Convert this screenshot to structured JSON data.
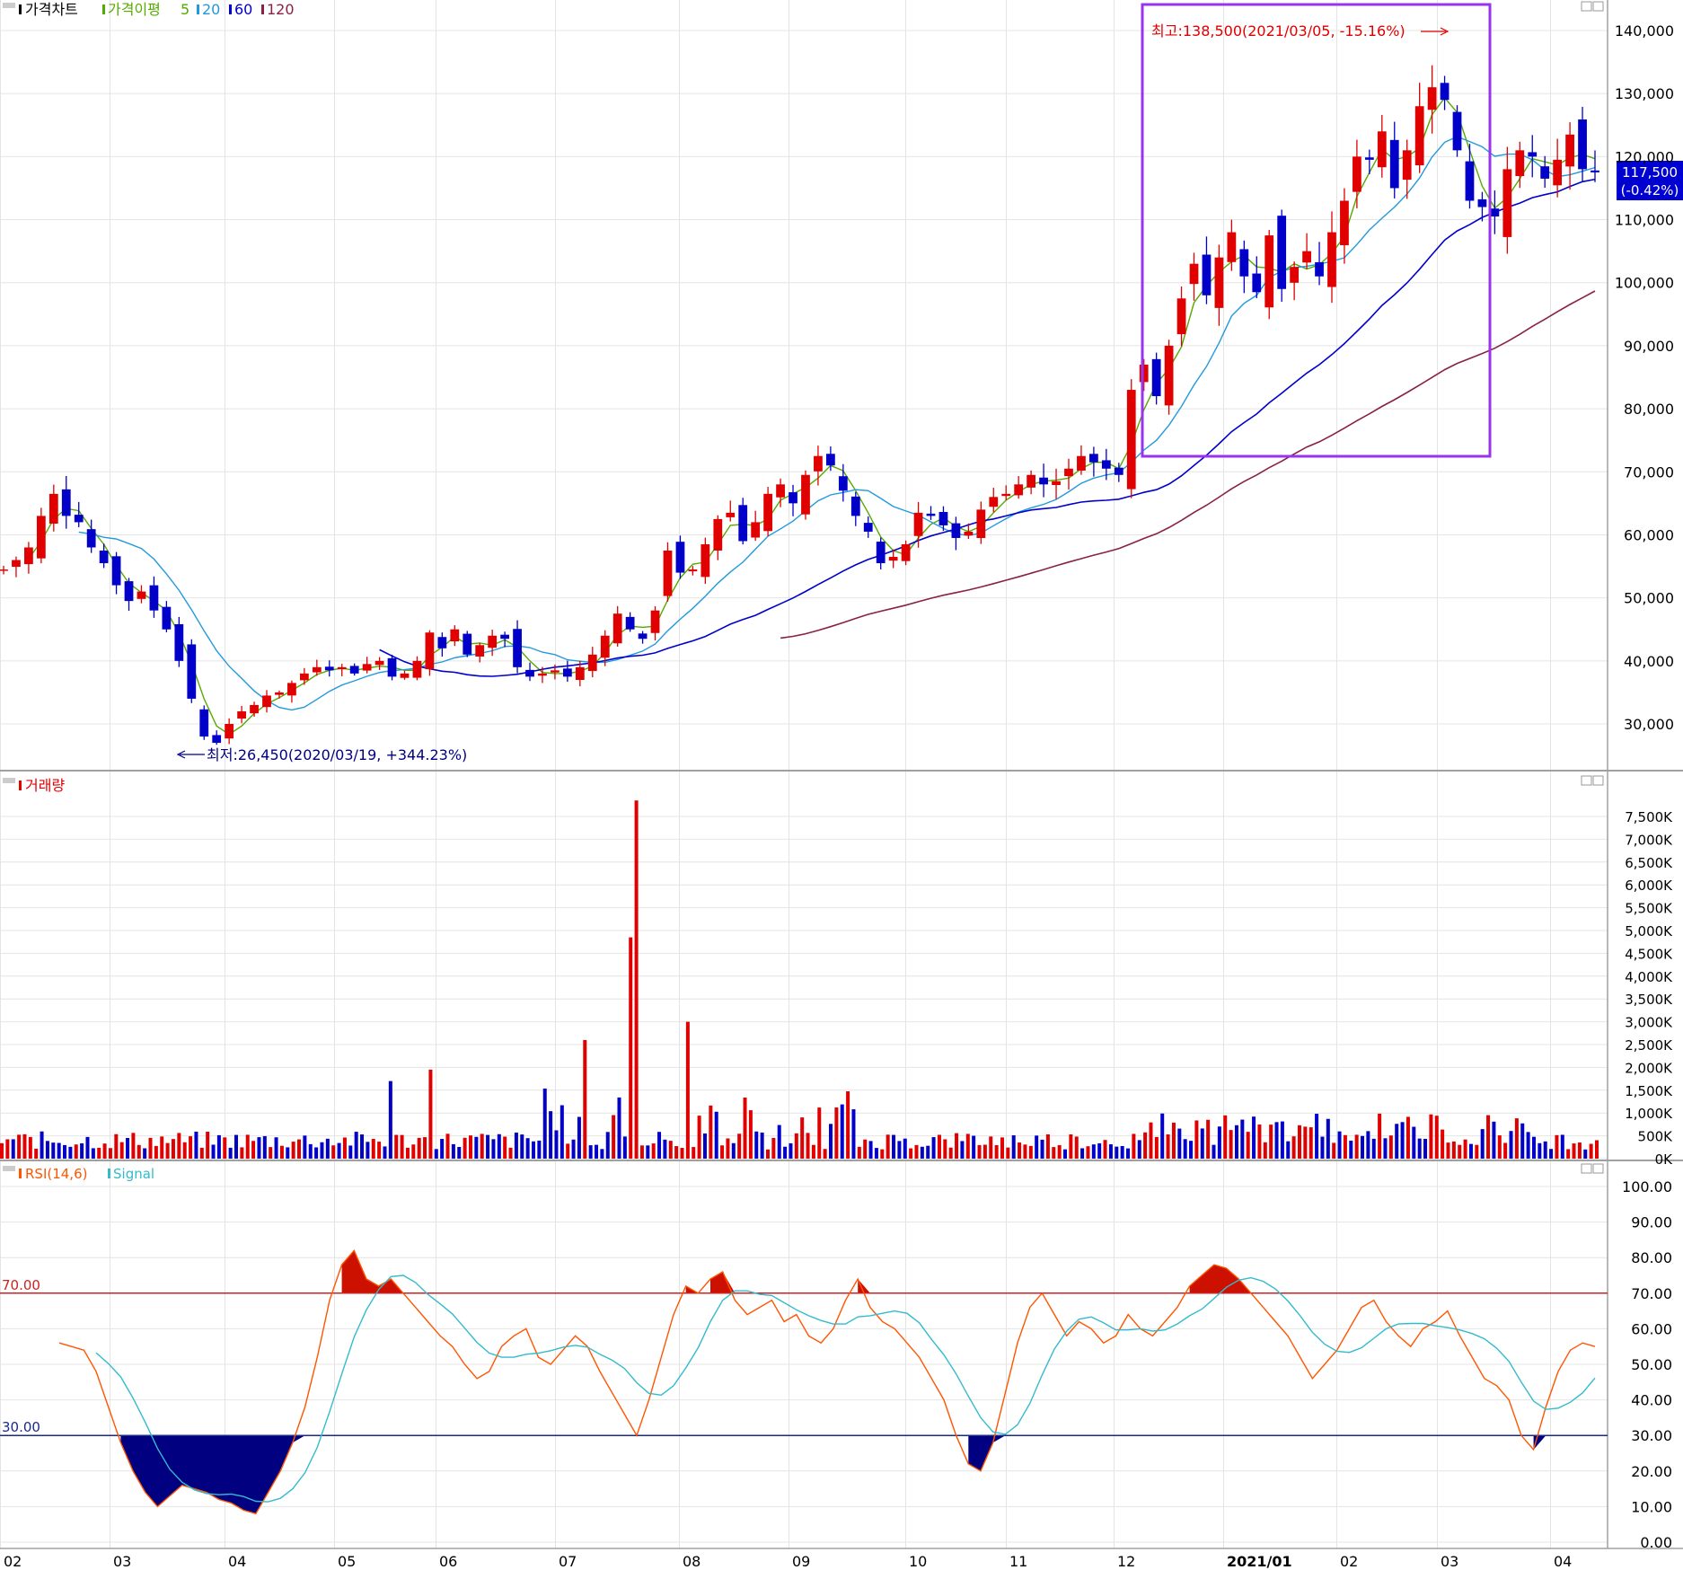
{
  "legend": {
    "price": "가격차트",
    "ma_label": "가격이평",
    "ma5": "5",
    "ma20": "20",
    "ma60": "60",
    "ma120": "120",
    "volume": "거래량",
    "rsi": "RSI(14,6)",
    "signal": "Signal"
  },
  "annotations": {
    "high": "최고:138,500(2021/03/05, -15.16%)",
    "low": "최저:26,450(2020/03/19, +344.23%)",
    "last_price": "117,500",
    "last_change": "(-0.42%)",
    "rsi_upper": "70.00",
    "rsi_lower": "30.00"
  },
  "colors": {
    "up": "#e00000",
    "down": "#0000c8",
    "ma5": "#55aa00",
    "ma20": "#2299dd",
    "ma60": "#0000cc",
    "ma120": "#882244",
    "rsi": "#ff5500",
    "signal": "#33bbcc",
    "highlight_box": "#9933ee",
    "grid": "#e4e4e4"
  },
  "x_labels": [
    "02",
    "03",
    "04",
    "05",
    "06",
    "07",
    "08",
    "09",
    "10",
    "11",
    "12",
    "2021/01",
    "02",
    "03",
    "04"
  ],
  "price_ticks": [
    "140,000",
    "130,000",
    "120,000",
    "110,000",
    "100,000",
    "90,000",
    "80,000",
    "70,000",
    "60,000",
    "50,000",
    "40,000",
    "30,000"
  ],
  "volume_ticks": [
    "7,500K",
    "7,000K",
    "6,500K",
    "6,000K",
    "5,500K",
    "5,000K",
    "4,500K",
    "4,000K",
    "3,500K",
    "3,000K",
    "2,500K",
    "2,000K",
    "1,500K",
    "1,000K",
    "500K",
    "0K"
  ],
  "rsi_ticks": [
    "100.00",
    "90.00",
    "80.00",
    "70.00",
    "60.00",
    "50.00",
    "40.00",
    "30.00",
    "20.00",
    "10.00",
    "0.00"
  ],
  "chart_data": {
    "type": "candlestick",
    "period": "2020/02 – 2021/04 (daily)",
    "price": {
      "ylim": [
        22000,
        143000
      ],
      "high": {
        "value": 138500,
        "date": "2021/03/05"
      },
      "low": {
        "value": 26450,
        "date": "2020/03/19"
      },
      "last": 117500,
      "change_pct": -0.42,
      "closes": [
        54500,
        56000,
        58000,
        63000,
        66500,
        63000,
        62000,
        58000,
        55500,
        52000,
        49500,
        51000,
        48000,
        45000,
        40000,
        34000,
        28000,
        27000,
        30000,
        32000,
        33000,
        34500,
        35000,
        36500,
        38000,
        39000,
        38500,
        39000,
        38000,
        39500,
        40000,
        37500,
        38000,
        40000,
        44500,
        42000,
        45000,
        41000,
        42500,
        44000,
        43500,
        39000,
        37500,
        38000,
        38500,
        37500,
        39000,
        41000,
        44000,
        47500,
        45000,
        43500,
        48000,
        57500,
        54000,
        54500,
        58500,
        62500,
        63500,
        59000,
        62000,
        66500,
        68000,
        65000,
        69500,
        72500,
        71000,
        67000,
        63000,
        60500,
        55500,
        56500,
        58500,
        63500,
        63000,
        61500,
        59500,
        60500,
        64000,
        66000,
        66500,
        68000,
        69500,
        68000,
        68500,
        70500,
        72500,
        71500,
        70500,
        69500,
        83000,
        87000,
        82000,
        90000,
        97500,
        103000,
        98000,
        104000,
        108000,
        101000,
        98500,
        107500,
        99000,
        102500,
        105000,
        101000,
        108000,
        113000,
        120000,
        119500,
        124000,
        115000,
        121000,
        128000,
        131000,
        129000,
        121000,
        113000,
        112000,
        110500,
        118000,
        121000,
        120000,
        116500,
        119500,
        123500,
        118000,
        117500
      ],
      "ma_last": {
        "ma5": 118500,
        "ma20": 117000,
        "ma60": 115000,
        "ma120": 94500
      }
    },
    "volume": {
      "ylim": [
        0,
        7900
      ],
      "unit": "K",
      "peak": {
        "value": 7850,
        "month": "07"
      },
      "notable": [
        {
          "month": "07",
          "value": 4850
        },
        {
          "month": "07",
          "value": 2600
        },
        {
          "month": "08",
          "value": 3000
        },
        {
          "month": "06",
          "value": 1950
        },
        {
          "month": "05",
          "value": 1700
        }
      ]
    },
    "rsi": {
      "period": 14,
      "signal_period": 6,
      "ylim": [
        0,
        100
      ],
      "upper": 70,
      "lower": 30,
      "values": [
        56,
        55,
        54,
        48,
        38,
        28,
        20,
        14,
        10,
        13,
        16,
        15,
        14,
        12,
        11,
        9,
        8,
        14,
        20,
        28,
        38,
        52,
        68,
        78,
        82,
        74,
        72,
        74,
        70,
        66,
        62,
        58,
        55,
        50,
        46,
        48,
        55,
        58,
        60,
        52,
        50,
        54,
        58,
        55,
        48,
        42,
        36,
        30,
        40,
        52,
        64,
        72,
        70,
        74,
        76,
        68,
        64,
        66,
        68,
        62,
        64,
        58,
        56,
        60,
        68,
        74,
        66,
        62,
        60,
        56,
        52,
        46,
        40,
        30,
        22,
        20,
        28,
        42,
        56,
        66,
        70,
        64,
        58,
        62,
        60,
        56,
        58,
        64,
        60,
        58,
        62,
        66,
        72,
        75,
        78,
        77,
        74,
        70,
        66,
        62,
        58,
        52,
        46,
        50,
        54,
        60,
        66,
        68,
        62,
        58,
        55,
        60,
        62,
        65,
        58,
        52,
        46,
        44,
        40,
        30,
        26,
        38,
        48,
        54,
        56,
        55
      ]
    },
    "x": [
      "02",
      "03",
      "04",
      "05",
      "06",
      "07",
      "08",
      "09",
      "10",
      "11",
      "12",
      "2021/01",
      "02",
      "03",
      "04"
    ]
  }
}
